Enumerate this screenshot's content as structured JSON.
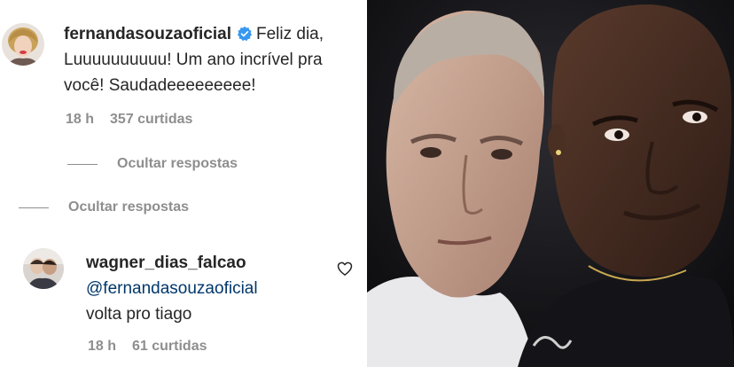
{
  "first_comment": {
    "username": "fernandasouzaoficial",
    "text_line1": "Feliz dia,",
    "text_line2": "Luuuuuuuuuu! Um ano incrível pra",
    "text_line3": "você! Saudadeeeeeeeee!",
    "time": "18 h",
    "likes": "357 curtidas",
    "verified_icon": "verified-badge-icon",
    "verified_color": "#3897f0"
  },
  "hide_replies_nested": "Ocultar respostas",
  "hide_replies_main": "Ocultar respostas",
  "reply": {
    "username": "wagner_dias_falcao",
    "mention": "@fernandasouzaoficial",
    "text": "volta pro tiago",
    "time": "18 h",
    "likes": "61 curtidas",
    "like_icon": "heart-icon"
  },
  "colors": {
    "text": "#262626",
    "secondary": "#8e8e8e",
    "mention": "#00376b"
  }
}
